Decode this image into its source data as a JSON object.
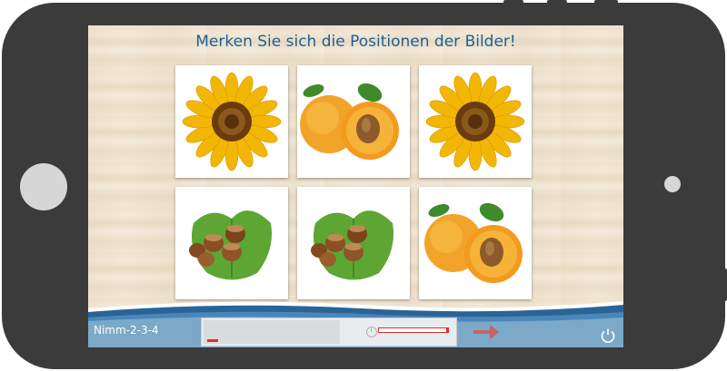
{
  "screen": {
    "title": "Merken Sie sich die Positionen der Bilder!",
    "level_label": "Nimm-2-3-4"
  },
  "cards": [
    {
      "image": "sunflower"
    },
    {
      "image": "apricot"
    },
    {
      "image": "sunflower"
    },
    {
      "image": "hazelnuts"
    },
    {
      "image": "hazelnuts"
    },
    {
      "image": "apricot"
    }
  ],
  "progress": {
    "memorize_fraction": 0.05,
    "time_remaining_fraction": 0.03
  },
  "icons": {
    "next": "arrow-right-icon",
    "power": "power-icon",
    "timer": "clock-icon"
  },
  "colors": {
    "title": "#1f5f96",
    "accent_red": "#d8312a",
    "wave_blue": "#2a6496"
  }
}
